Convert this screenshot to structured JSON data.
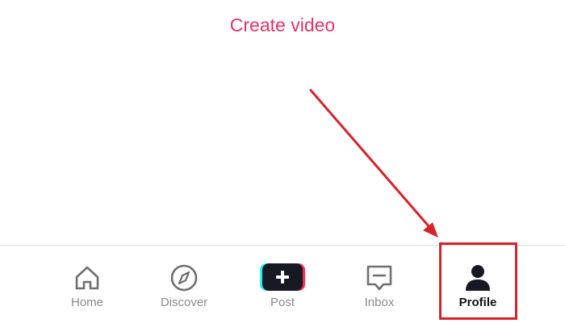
{
  "header": {
    "create_video_label": "Create video"
  },
  "tab_bar": {
    "tabs": [
      {
        "label": "Home",
        "icon": "home-icon"
      },
      {
        "label": "Discover",
        "icon": "compass-icon"
      },
      {
        "label": "Post",
        "icon": "plus-icon"
      },
      {
        "label": "Inbox",
        "icon": "inbox-icon"
      },
      {
        "label": "Profile",
        "icon": "person-icon",
        "active": true
      }
    ]
  },
  "colors": {
    "create_video": "#e0336b",
    "annotation": "#d7222a",
    "post_left_accent": "#25f4ee",
    "post_right_accent": "#fe2c55",
    "active_label": "#111111",
    "inactive_label": "#8a8a8a"
  }
}
